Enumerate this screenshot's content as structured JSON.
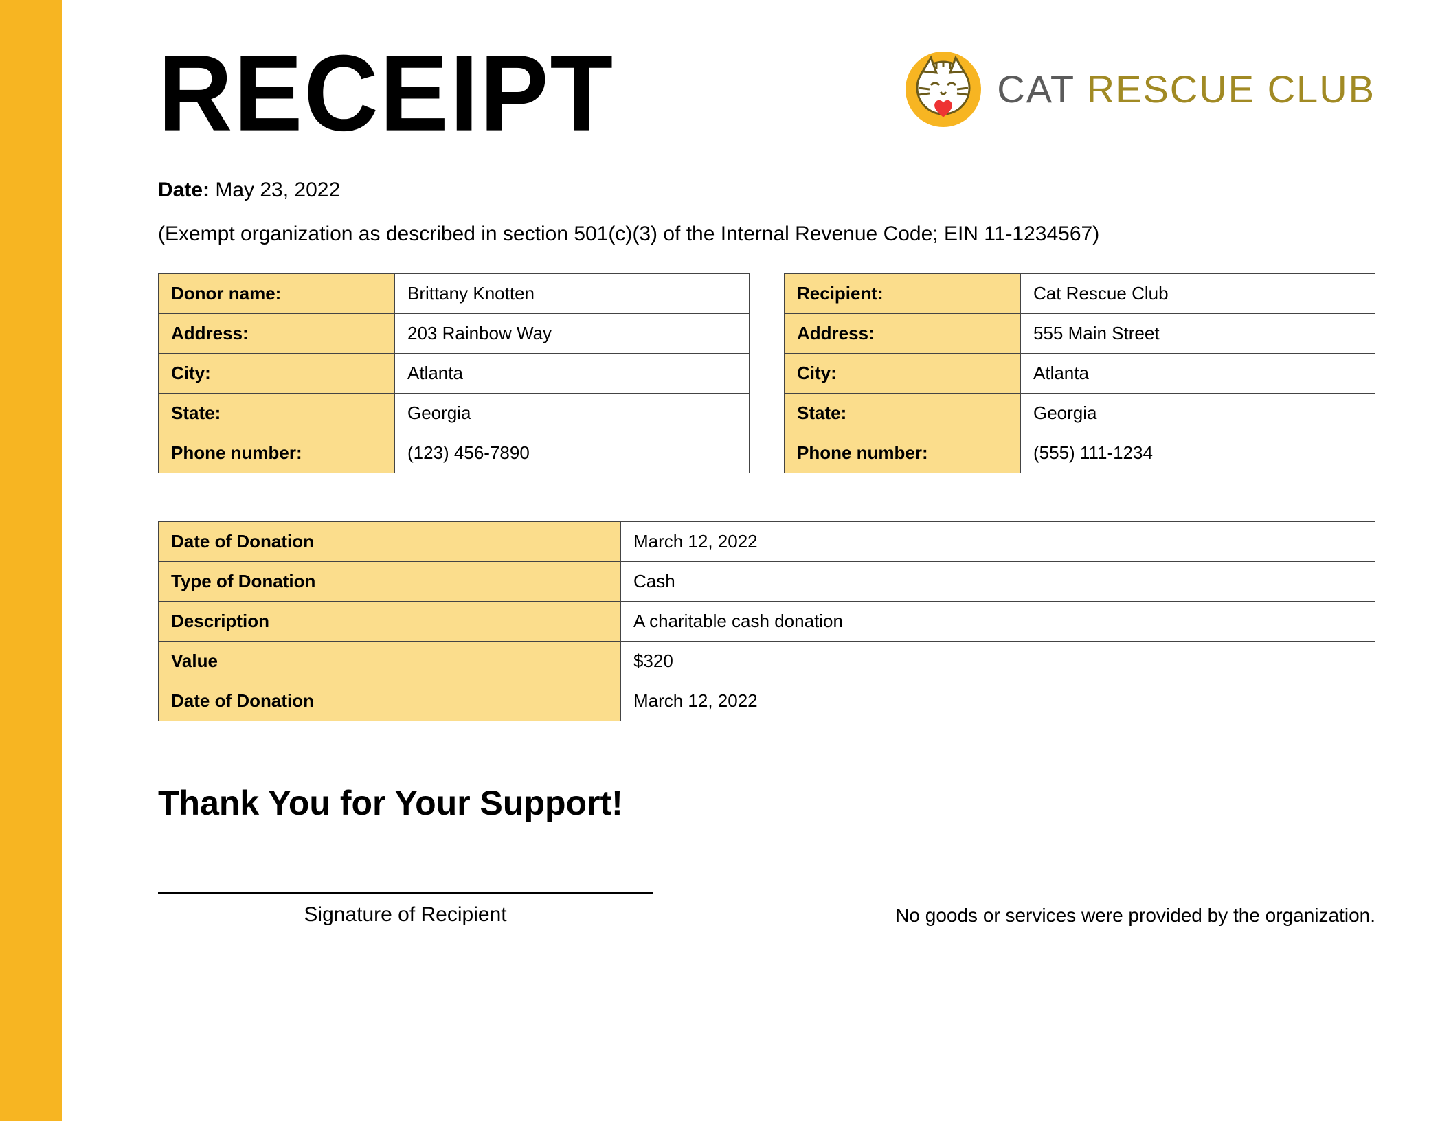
{
  "header": {
    "title": "RECEIPT",
    "logo_cat": "CAT",
    "logo_rescue": "RESCUE",
    "logo_club": "CLUB"
  },
  "date_label": "Date:",
  "date_value": "May 23, 2022",
  "exempt_line": "(Exempt organization as described in section 501(c)(3) of the Internal Revenue Code; EIN 11-1234567)",
  "donor_labels": {
    "name": "Donor name:",
    "address": "Address:",
    "city": "City:",
    "state": "State:",
    "phone": "Phone number:"
  },
  "donor": {
    "name": "Brittany Knotten",
    "address": "203 Rainbow Way",
    "city": "Atlanta",
    "state": "Georgia",
    "phone": "(123) 456-7890"
  },
  "recipient_labels": {
    "name": "Recipient:",
    "address": "Address:",
    "city": "City:",
    "state": "State:",
    "phone": "Phone number:"
  },
  "recipient": {
    "name": "Cat Rescue Club",
    "address": "555 Main Street",
    "city": "Atlanta",
    "state": "Georgia",
    "phone": "(555) 111-1234"
  },
  "donation_labels": {
    "date1": "Date of Donation",
    "type": "Type of Donation",
    "desc": "Description",
    "value": "Value",
    "date2": "Date of Donation"
  },
  "donation": {
    "date1": "March 12, 2022",
    "type": "Cash",
    "desc": "A charitable cash donation",
    "value": "$320",
    "date2": "March 12, 2022"
  },
  "thanks": "Thank You for Your Support!",
  "signature_label": "Signature of Recipient",
  "disclaimer": "No goods or services were provided by the organization."
}
